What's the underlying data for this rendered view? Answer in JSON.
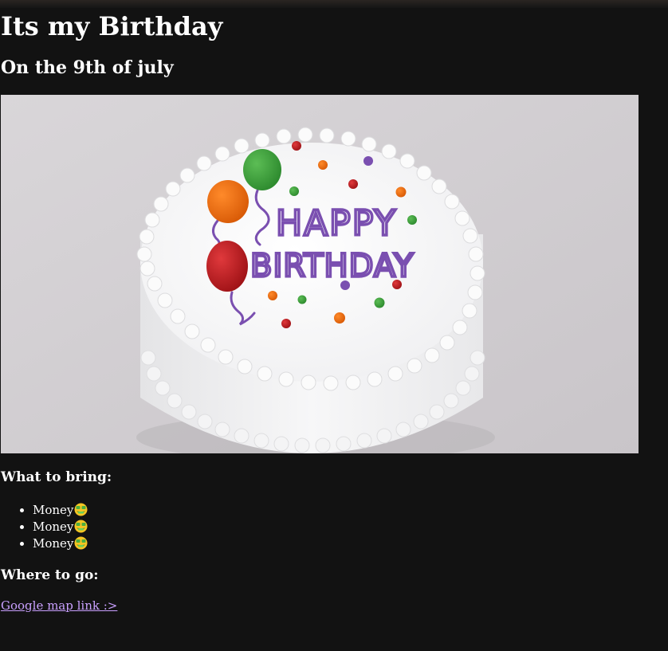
{
  "page": {
    "title": "Its my Birthday",
    "subtitle": "On the 9th of july"
  },
  "image": {
    "cake_text_line1": "HAPPY",
    "cake_text_line2": "BIRTHDAY"
  },
  "bring": {
    "heading": "What to bring:",
    "items": [
      {
        "label": "Money",
        "icon": "money-mouth-face-icon"
      },
      {
        "label": "Money",
        "icon": "money-mouth-face-icon"
      },
      {
        "label": "Money",
        "icon": "money-mouth-face-icon"
      }
    ]
  },
  "where": {
    "heading": "Where to go:",
    "link_text": "Google map link :>"
  },
  "colors": {
    "background": "#121212",
    "text": "#ffffff",
    "link": "#c9a0ff",
    "cake_lettering": "#7a4fb0"
  }
}
